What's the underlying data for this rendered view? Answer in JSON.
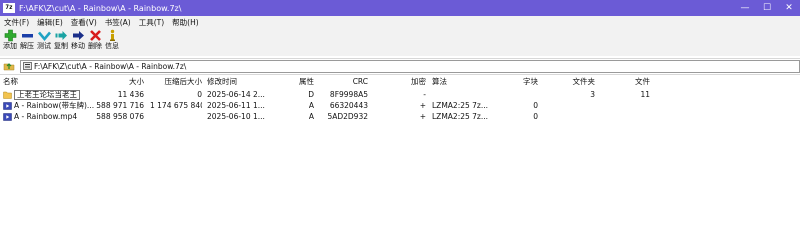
{
  "window": {
    "app_icon_text": "7z",
    "title": "F:\\AFK\\Z\\cut\\A - Rainbow\\A - Rainbow.7z\\",
    "minimize_glyph": "—",
    "maximize_glyph": "☐",
    "close_glyph": "✕"
  },
  "menu": [
    "文件(F)",
    "编辑(E)",
    "查看(V)",
    "书签(A)",
    "工具(T)",
    "帮助(H)"
  ],
  "toolbar": [
    {
      "label": "添加",
      "icon": "add-icon",
      "color": "#2faa2f"
    },
    {
      "label": "解压",
      "icon": "extract-icon",
      "color": "#1b3fa8"
    },
    {
      "label": "测试",
      "icon": "test-icon",
      "color": "#1fa3c4"
    },
    {
      "label": "复制",
      "icon": "copy-icon",
      "color": "#1aa3a3"
    },
    {
      "label": "移动",
      "icon": "move-icon",
      "color": "#1b2f8a"
    },
    {
      "label": "删除",
      "icon": "delete-icon",
      "color": "#d81b1b"
    },
    {
      "label": "信息",
      "icon": "info-icon",
      "color": "#c8a000"
    }
  ],
  "address": {
    "path": "F:\\AFK\\Z\\cut\\A - Rainbow\\A - Rainbow.7z\\"
  },
  "columns": {
    "name": "名称",
    "size": "大小",
    "packed": "压缩后大小",
    "modified": "修改时间",
    "attributes": "属性",
    "crc": "CRC",
    "encrypted": "加密",
    "method": "算法",
    "characteristics": "字块",
    "folders": "文件夹",
    "files": "文件"
  },
  "rows": [
    {
      "name": "上老王论坛当老王",
      "size": "11 436",
      "packed": "0",
      "modified": "2025-06-14 2...",
      "attributes": "D",
      "crc": "8F9998A5",
      "encrypted": "-",
      "method": "",
      "characteristics": "",
      "folders": "3",
      "files": "11",
      "icon": "folder-icon"
    },
    {
      "name": "A - Rainbow(带车牌)...",
      "size": "588 971 716",
      "packed": "1 174 675 840",
      "modified": "2025-06-11 1...",
      "attributes": "A",
      "crc": "66320443",
      "encrypted": "+",
      "method": "LZMA2:25 7z...",
      "characteristics": "0",
      "folders": "",
      "files": "",
      "icon": "video-file-icon"
    },
    {
      "name": "A - Rainbow.mp4",
      "size": "588 958 076",
      "packed": "",
      "modified": "2025-06-10 1...",
      "attributes": "A",
      "crc": "5AD2D932",
      "encrypted": "+",
      "method": "LZMA2:25 7z...",
      "characteristics": "0",
      "folders": "",
      "files": "",
      "icon": "video-file-icon"
    }
  ]
}
